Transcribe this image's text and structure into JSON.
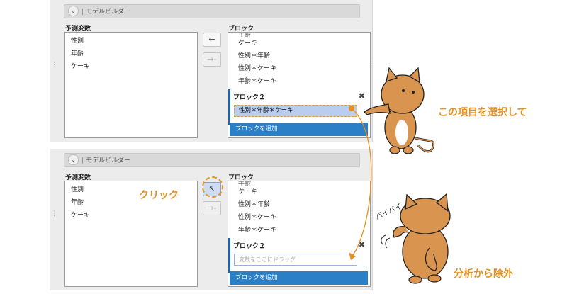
{
  "model_builder_label": "モデルビルダー",
  "predictors_label": "予測変数",
  "predictors": [
    "性別",
    "年齢",
    "ケーキ"
  ],
  "block_label": "ブロック",
  "block_terms": [
    "ケーキ",
    "性別＊年齢",
    "性別＊ケーキ",
    "年齢＊ケーキ"
  ],
  "block2_title": "ブロック２",
  "selected_term": "性別＊年齢＊ケーキ",
  "drop_placeholder": "変数をここにドラッグ",
  "add_block_label": "ブロックを追加",
  "arrow_left_glyph": "←",
  "arrow_right_glyph": "→-",
  "close_glyph": "✖",
  "chevron_glyph": "⌄",
  "cursor_glyph": "↖",
  "captions": {
    "select": "この項目を選択して",
    "click": "クリック",
    "remove": "分析から除外",
    "byebye": "バイバイ"
  },
  "colors": {
    "accent": "#e6911f",
    "add_button": "#2a7fc6",
    "block_border": "#1e63ae",
    "selected_bg": "#b9cdf0",
    "cat_body": "#d9944f"
  }
}
